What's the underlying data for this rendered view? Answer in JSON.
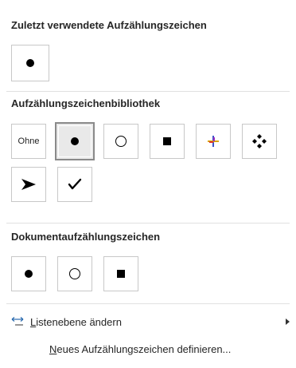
{
  "sections": {
    "recent": {
      "title": "Zuletzt verwendete Aufzählungszeichen",
      "items": [
        {
          "name": "filled-circle-bullet"
        }
      ]
    },
    "library": {
      "title": "Aufzählungszeichenbibliothek",
      "none_label": "Ohne",
      "selected": "filled-circle-bullet",
      "items": [
        {
          "name": "none"
        },
        {
          "name": "filled-circle-bullet"
        },
        {
          "name": "hollow-circle-bullet"
        },
        {
          "name": "filled-square-bullet"
        },
        {
          "name": "colorful-star-bullet"
        },
        {
          "name": "four-diamond-bullet"
        },
        {
          "name": "arrowhead-bullet"
        },
        {
          "name": "checkmark-bullet"
        }
      ]
    },
    "document": {
      "title": "Dokumentaufzählungszeichen",
      "items": [
        {
          "name": "filled-circle-bullet"
        },
        {
          "name": "hollow-circle-bullet"
        },
        {
          "name": "filled-square-bullet"
        }
      ]
    }
  },
  "menu": {
    "change_list_level": {
      "accel": "L",
      "rest": "istenebene ändern",
      "icon": "indent-arrows-icon",
      "has_submenu": true
    },
    "define_new_bullet": {
      "accel": "N",
      "rest": "eues Aufzählungszeichen definieren..."
    }
  },
  "colors": {
    "tile_border": "#c8c8c8",
    "selected_bg": "#e9e9e9",
    "selected_border": "#8a8a8a",
    "accent_blue": "#2b6cb0"
  }
}
